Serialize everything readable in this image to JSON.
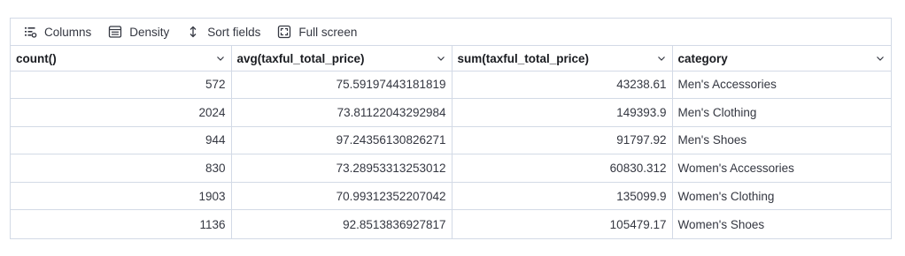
{
  "toolbar": {
    "columns_label": "Columns",
    "density_label": "Density",
    "sort_label": "Sort fields",
    "fullscreen_label": "Full screen"
  },
  "columns": [
    {
      "label": "count()",
      "align": "right"
    },
    {
      "label": "avg(taxful_total_price)",
      "align": "right"
    },
    {
      "label": "sum(taxful_total_price)",
      "align": "right"
    },
    {
      "label": "category",
      "align": "left"
    }
  ],
  "rows": [
    [
      "572",
      "75.59197443181819",
      "43238.61",
      "Men's Accessories"
    ],
    [
      "2024",
      "73.81122043292984",
      "149393.9",
      "Men's Clothing"
    ],
    [
      "944",
      "97.24356130826271",
      "91797.92",
      "Men's Shoes"
    ],
    [
      "830",
      "73.28953313253012",
      "60830.312",
      "Women's Accessories"
    ],
    [
      "1903",
      "70.99312352207042",
      "135099.9",
      "Women's Clothing"
    ],
    [
      "1136",
      "92.8513836927817",
      "105479.17",
      "Women's Shoes"
    ]
  ]
}
